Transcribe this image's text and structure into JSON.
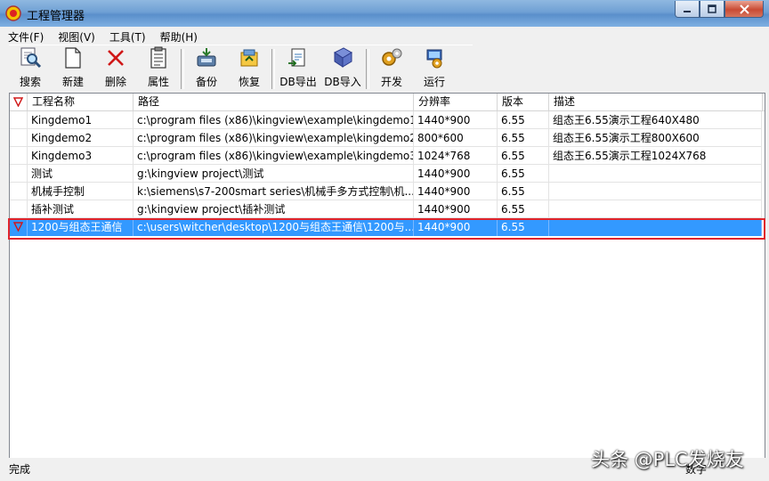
{
  "window": {
    "title": "工程管理器"
  },
  "menu": [
    "文件(F)",
    "视图(V)",
    "工具(T)",
    "帮助(H)"
  ],
  "toolbar": {
    "groups": [
      [
        {
          "label": "搜索",
          "icon": "search-icon"
        },
        {
          "label": "新建",
          "icon": "new-document-icon"
        },
        {
          "label": "删除",
          "icon": "delete-x-icon"
        },
        {
          "label": "属性",
          "icon": "properties-icon"
        }
      ],
      [
        {
          "label": "备份",
          "icon": "backup-icon"
        },
        {
          "label": "恢复",
          "icon": "restore-icon"
        }
      ],
      [
        {
          "label": "DB导出",
          "icon": "db-export-icon"
        },
        {
          "label": "DB导入",
          "icon": "db-import-icon"
        }
      ],
      [
        {
          "label": "开发",
          "icon": "develop-icon"
        },
        {
          "label": "运行",
          "icon": "run-icon"
        }
      ]
    ]
  },
  "table": {
    "columns": [
      "工程名称",
      "路径",
      "分辨率",
      "版本",
      "描述"
    ],
    "rows": [
      {
        "name": "Kingdemo1",
        "path": "c:\\program files (x86)\\kingview\\example\\kingdemo1",
        "res": "1440*900",
        "ver": "6.55",
        "desc": "组态王6.55演示工程640X480",
        "selected": false
      },
      {
        "name": "Kingdemo2",
        "path": "c:\\program files (x86)\\kingview\\example\\kingdemo2",
        "res": "800*600",
        "ver": "6.55",
        "desc": "组态王6.55演示工程800X600",
        "selected": false
      },
      {
        "name": "Kingdemo3",
        "path": "c:\\program files (x86)\\kingview\\example\\kingdemo3",
        "res": "1024*768",
        "ver": "6.55",
        "desc": "组态王6.55演示工程1024X768",
        "selected": false
      },
      {
        "name": "测试",
        "path": "g:\\kingview project\\测试",
        "res": "1440*900",
        "ver": "6.55",
        "desc": "",
        "selected": false
      },
      {
        "name": "机械手控制",
        "path": "k:\\siemens\\s7-200smart series\\机械手多方式控制\\机...",
        "res": "1440*900",
        "ver": "6.55",
        "desc": "",
        "selected": false
      },
      {
        "name": "插补测试",
        "path": "g:\\kingview project\\插补测试",
        "res": "1440*900",
        "ver": "6.55",
        "desc": "",
        "selected": false
      },
      {
        "name": "1200与组态王通信",
        "path": "c:\\users\\witcher\\desktop\\1200与组态王通信\\1200与...",
        "res": "1440*900",
        "ver": "6.55",
        "desc": "",
        "selected": true
      }
    ]
  },
  "status": {
    "left": "完成",
    "right": "数字"
  },
  "watermark": "头条 @PLC发烧友",
  "colors": {
    "selection": "#3399ff",
    "highlight_outline": "#e0242c",
    "flag": "#d01818"
  }
}
